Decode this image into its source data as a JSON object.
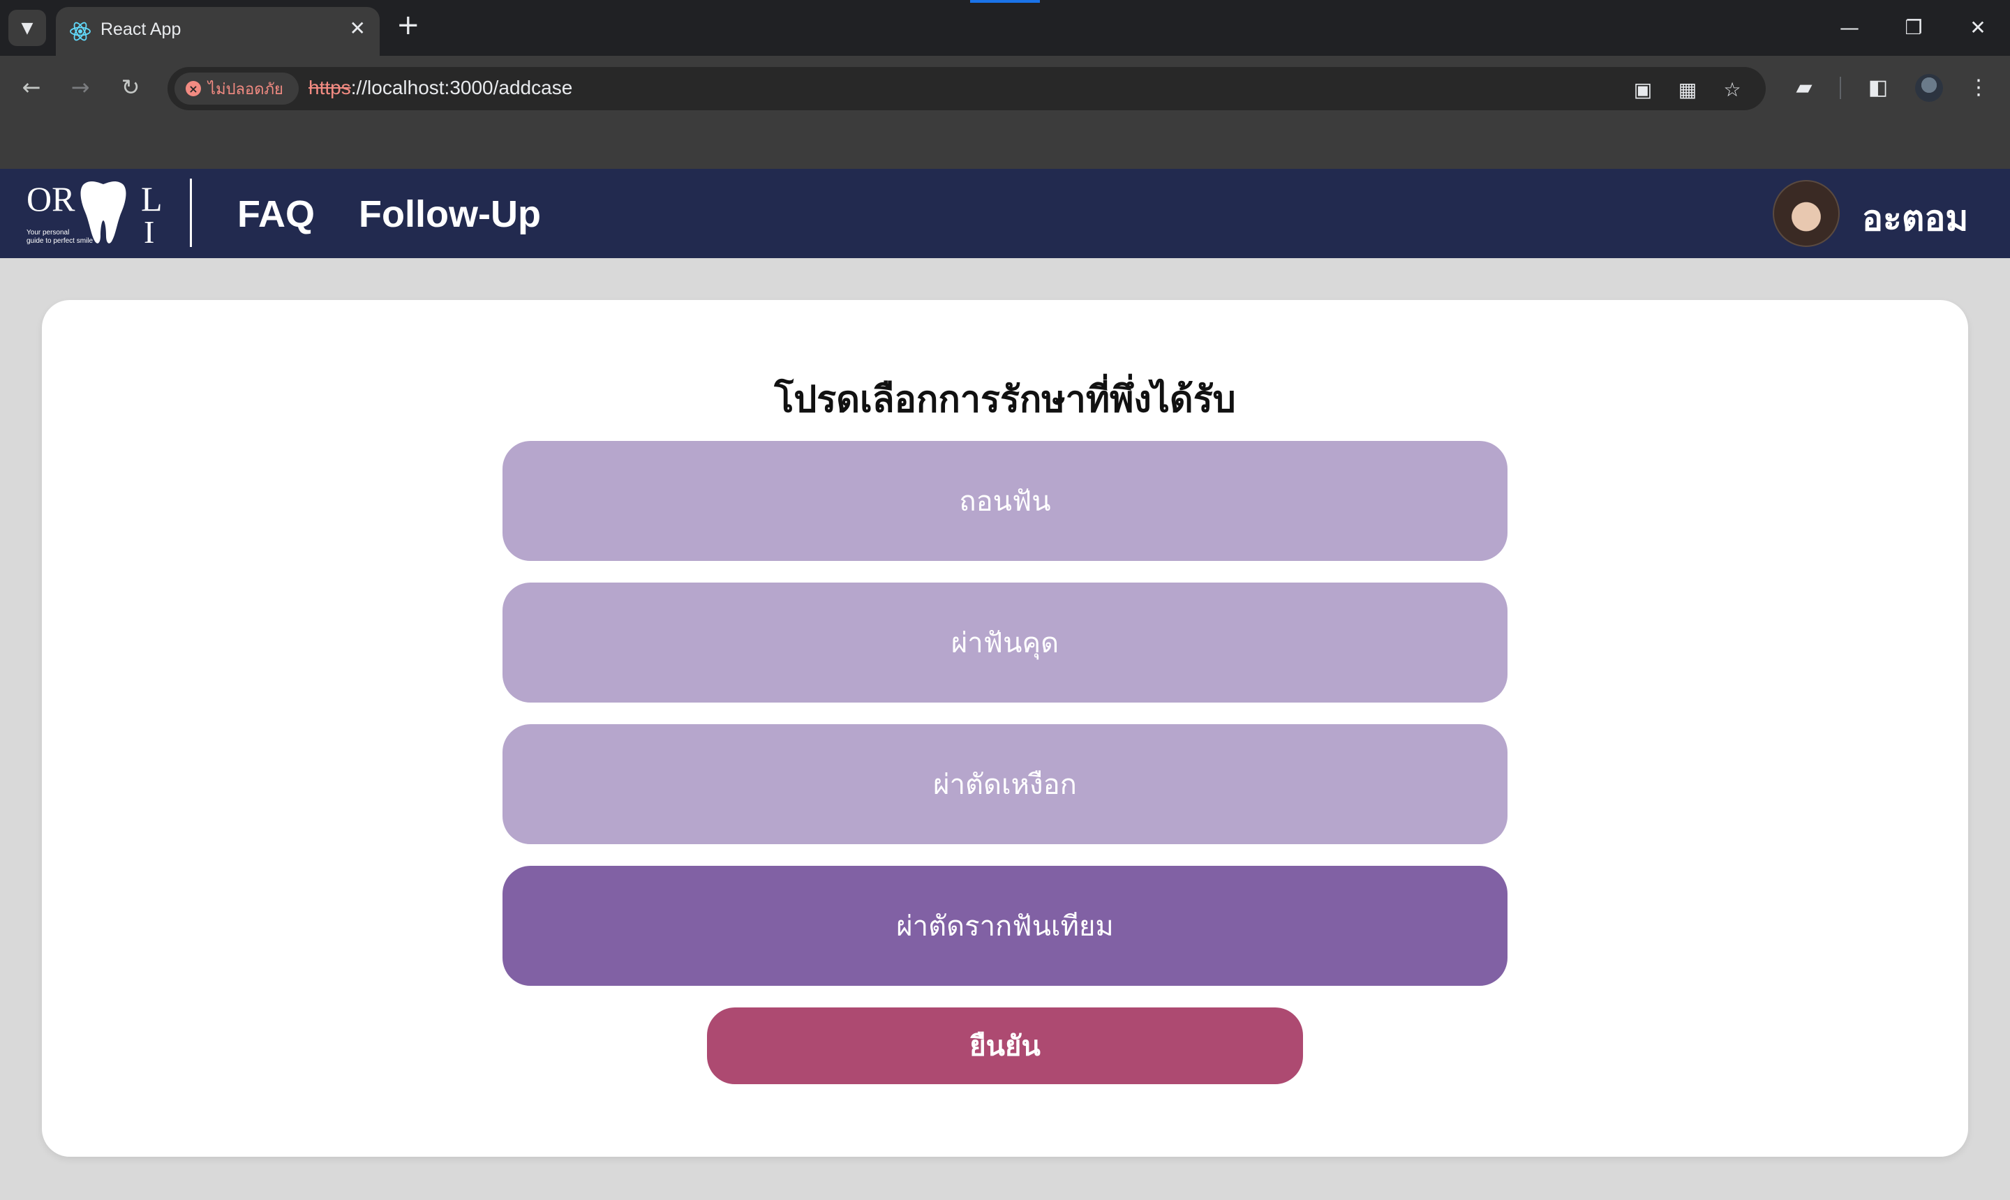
{
  "browser": {
    "tab_title": "React App",
    "security_label": "ไม่ปลอดภัย",
    "url_scheme": "https",
    "url_rest": "://localhost:3000/addcase"
  },
  "nav": {
    "logo_text": "ORAL",
    "logo_tagline_1": "Your personal",
    "logo_tagline_2": "guide to perfect smile",
    "links": [
      "FAQ",
      "Follow-Up"
    ],
    "user_name": "อะตอม"
  },
  "main": {
    "heading": "โปรดเลือกการรักษาที่พึ่งได้รับ",
    "options": [
      {
        "label": "ถอนฟัน",
        "selected": false
      },
      {
        "label": "ผ่าฟันคุด",
        "selected": false
      },
      {
        "label": "ผ่าตัดเหงือก",
        "selected": false
      },
      {
        "label": "ผ่าตัดรากฟันเทียม",
        "selected": true
      }
    ],
    "confirm_label": "ยืนยัน"
  },
  "colors": {
    "nav_bg": "#222a4f",
    "option": "#b6a6cc",
    "option_selected": "#8161a4",
    "confirm": "#ad4a71",
    "page_bg": "#d9d9d9"
  }
}
